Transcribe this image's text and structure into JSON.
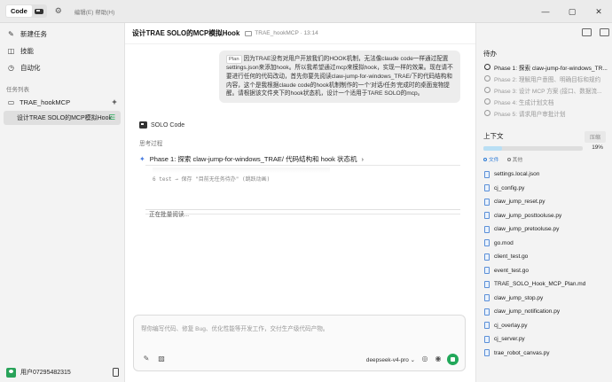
{
  "topbar": {
    "mode_code": "Code",
    "menu": "编辑(E)  帮助(H)",
    "win": {
      "minimize": "—",
      "maximize": "▢",
      "close": "✕"
    }
  },
  "sidebar": {
    "new_task": "新建任务",
    "skills": "技能",
    "automation": "自动化",
    "task_list_label": "任务列表",
    "project": "TRAE_hookMCP",
    "add_label": "+",
    "task": "设计TRAE SOLO的MCP模拟Hook",
    "user": "用户07295482315"
  },
  "main": {
    "title": "设计TRAE SOLO的MCP模拟Hook",
    "subtitle": "TRAE_hookMCP · 13:14",
    "plan_tag": "Plan",
    "user_message": "因为TRAE没有对用户开放我们的HOOK机制，无法像claude code一样通过配置settings.json来添加hook。所以我希望通过mcp来模拟hook，实现一样的效果。现在请不要进行任何的代码改动，首先你要先阅读claw-jump-for-windows_TRAE/下的代码结构和内容，这个是我根据claude code的hook机制制作的一个'对话/任务'完成时的桌面宠物提醒。请根据该文件夹下的hook状态机，设计一个适用于TARE SOLO的mcp。",
    "solo_label": "SOLO Code",
    "think_label": "思考过程",
    "phase_title": "Phase 1: 探索 claw-jump-for-windows_TRAE/ 代码结构和 hook 状态机",
    "code_line": "6  test → 保存 \"目前无任务待办\" (跳跃动画)",
    "reading": "正在批量阅读..."
  },
  "composer": {
    "placeholder": "帮你编写代码、修复 Bug、优化性能等开发工作，交付生产级代码产物。",
    "model": "deepseek-v4-pro ⌄"
  },
  "rpanel": {
    "todo_title": "待办",
    "todos": [
      {
        "label": "Phase 1: 探索 claw-jump-for-windows_TR...",
        "active": true
      },
      {
        "label": "Phase 2: 理解用户意图、明确目标和规约",
        "active": false
      },
      {
        "label": "Phase 3: 设计 MCP 方案 (接口、数据流...",
        "active": false
      },
      {
        "label": "Phase 4: 生成计划文档",
        "active": false
      },
      {
        "label": "Phase 5: 请求用户审批计划",
        "active": false
      }
    ],
    "context_title": "上下文",
    "context_btn": "压缩",
    "progress_pct": "19%",
    "progress_value": 0.19,
    "tabs": [
      "文件",
      "其他"
    ],
    "files": [
      "settings.local.json",
      "cj_config.py",
      "claw_jump_reset.py",
      "claw_jump_posttooluse.py",
      "claw_jump_pretooluse.py",
      "go.mod",
      "client_test.go",
      "event_test.go",
      "TRAE_SOLO_Hook_MCP_Plan.md",
      "claw_jump_stop.py",
      "claw_jump_notification.py",
      "cj_overlay.py",
      "cj_server.py",
      "trae_robot_canvas.py"
    ]
  },
  "colors": {
    "accent": "#22a85a",
    "link": "#2a7ad6",
    "progress": "#b9dff4"
  }
}
